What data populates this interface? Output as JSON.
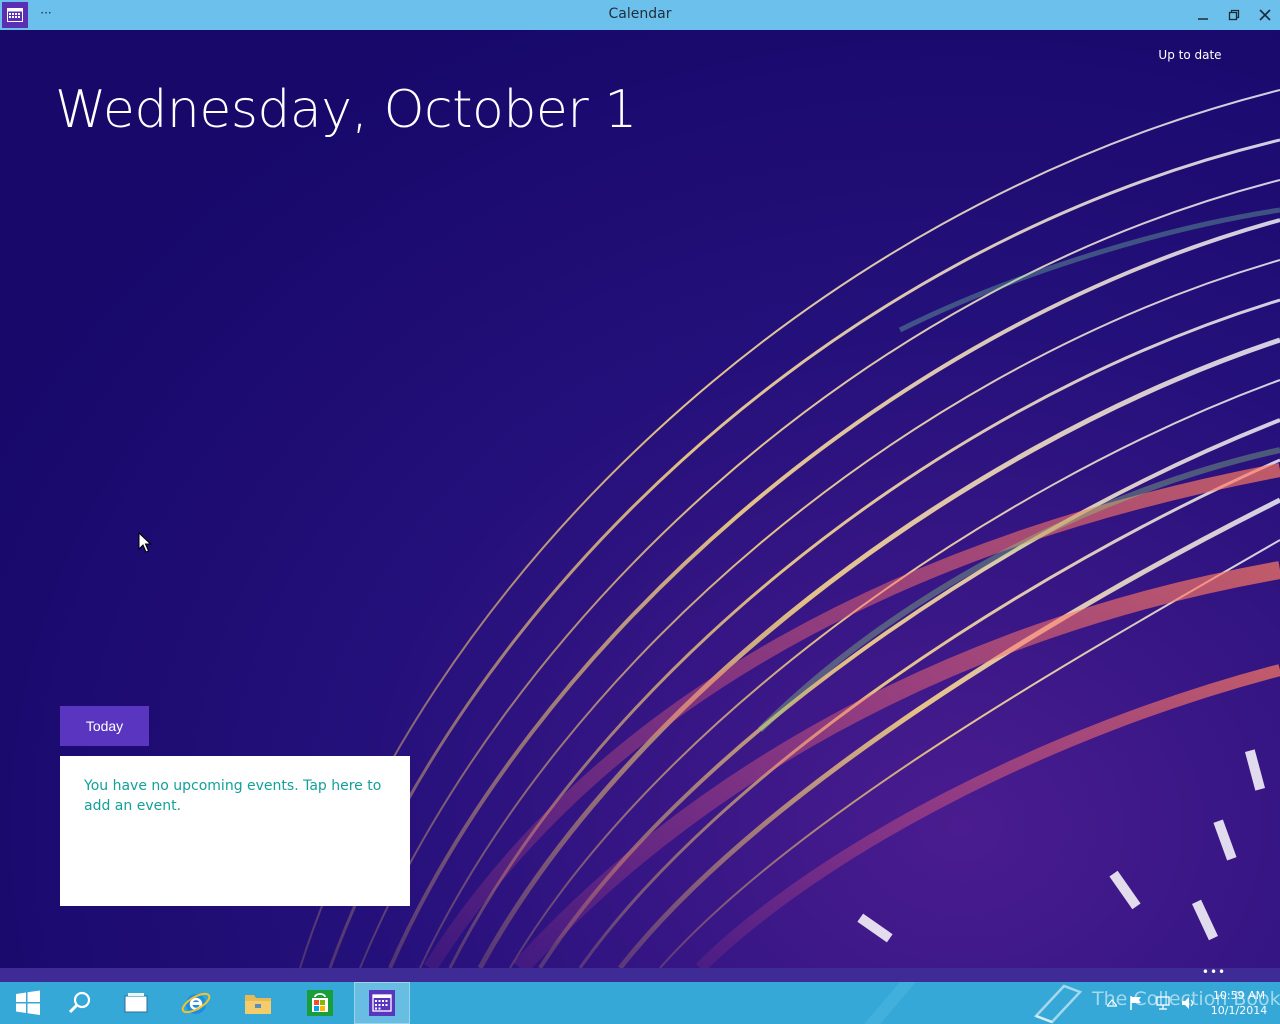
{
  "window": {
    "title": "Calendar",
    "menu_label": "···"
  },
  "app": {
    "sync_status": "Up to date",
    "date_heading": "Wednesday, October 1",
    "today_label": "Today",
    "events_message": "You have no upcoming events. Tap here to add an event."
  },
  "strip": {
    "more_label": "•••"
  },
  "taskbar": {
    "items": [
      "start-icon",
      "search-icon",
      "task-view-icon",
      "internet-explorer-icon",
      "file-explorer-icon",
      "store-icon",
      "calendar-icon"
    ],
    "active_item": "calendar-icon"
  },
  "tray": {
    "time": "10:59 AM",
    "date": "10/1/2014",
    "watermark": "The Collection Book",
    "icons": [
      "show-hidden-icons-icon",
      "action-center-flag-icon",
      "network-icon",
      "volume-icon"
    ]
  },
  "colors": {
    "titlebar": "#6cc0ec",
    "accent_purple": "#5a35c0",
    "taskbar": "#35a8d8",
    "event_text": "#12a19a"
  }
}
